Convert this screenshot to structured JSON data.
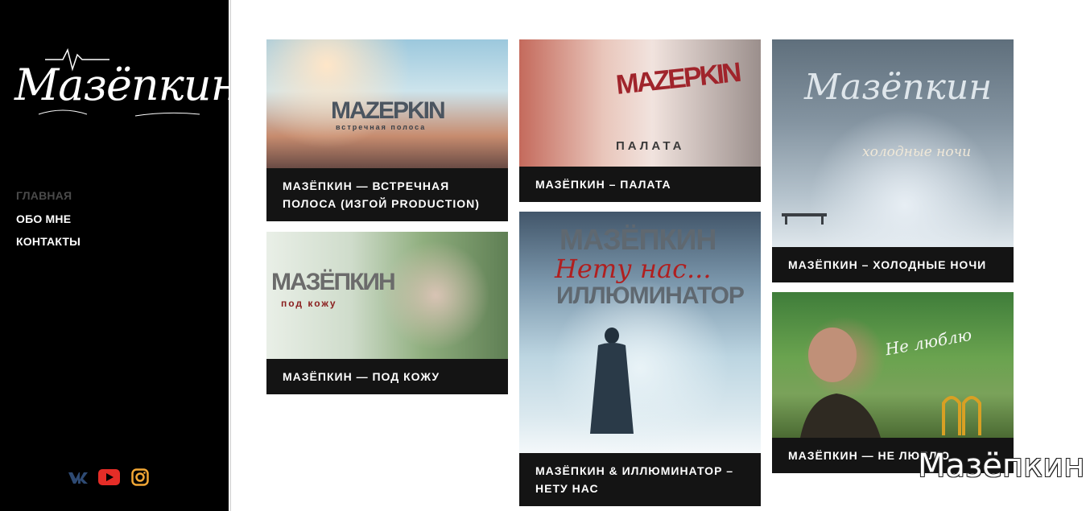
{
  "logo": {
    "text": "Мазёпкин"
  },
  "nav": {
    "items": [
      {
        "label": "ГЛАВНАЯ",
        "active": true
      },
      {
        "label": "ОБО МНЕ",
        "active": false
      },
      {
        "label": "КОНТАКТЫ",
        "active": false
      }
    ]
  },
  "social": [
    "vk-icon",
    "youtube-icon",
    "instagram-icon"
  ],
  "colors": {
    "sidebar": "#000000",
    "caption_bg": "#141414",
    "nav_active": "#4a4a4a",
    "youtube": "#e52d27",
    "vk": "#2e4a73",
    "instagram": "#f2a735"
  },
  "cards": [
    {
      "caption": "МАЗЁПКИН — ВСТРЕЧНАЯ ПОЛОСА (ИЗГОЙ PRODUCTION)",
      "art_title": "MAZEPKIN",
      "art_sub": "встречная полоса"
    },
    {
      "caption": "МАЗЁПКИН — ПОД КОЖУ",
      "art_title": "МАЗЁПКИН",
      "art_sub": "под кожу"
    },
    {
      "caption": "МАЗЁПКИН – ПАЛАТА",
      "art_title": "MAZEPKIN",
      "art_sub": "ПАЛАТА"
    },
    {
      "caption": "МАЗЁПКИН & ИЛЛЮМИНАТОР – НЕТУ НАС",
      "art_title": "МАЗЁПКИН",
      "art_script": "Нету нас...",
      "art_sub": "ИЛЛЮМИНАТОР"
    },
    {
      "caption": "МАЗЁПКИН – ХОЛОДНЫЕ НОЧИ",
      "art_title": "Мазёпкин",
      "art_sub": "холодные ночи"
    },
    {
      "caption": "МАЗЁПКИН — НЕ ЛЮБЛЮ",
      "art_sub": "Не люблю"
    }
  ],
  "watermark": {
    "text": "Мазёпкин"
  }
}
